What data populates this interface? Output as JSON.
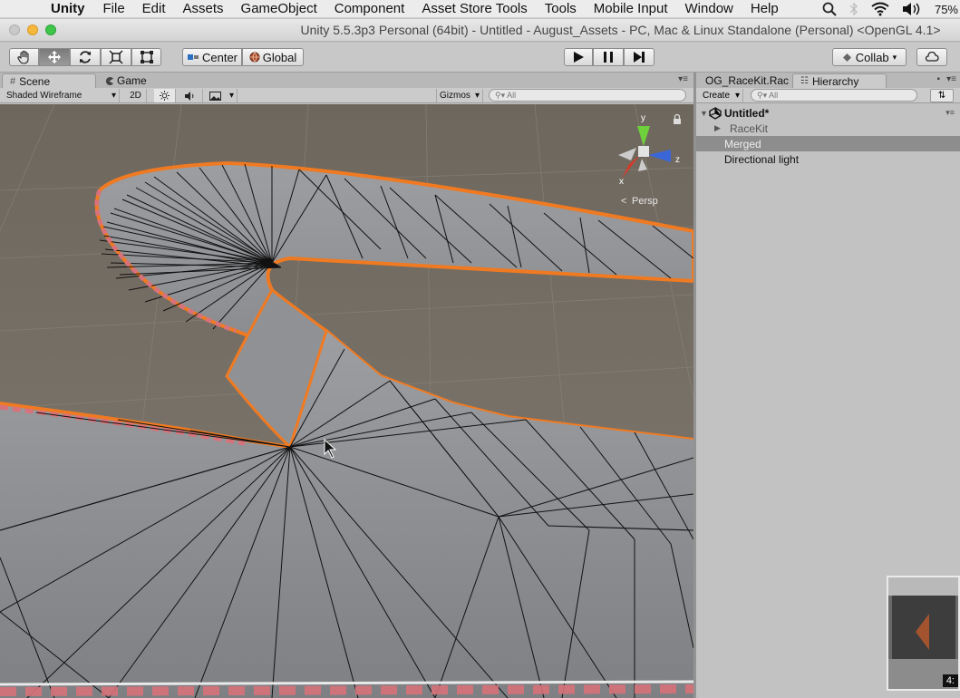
{
  "menubar": {
    "apple_glyph": "",
    "app_name": "Unity",
    "items": [
      "File",
      "Edit",
      "Assets",
      "GameObject",
      "Component",
      "Asset Store Tools",
      "Tools",
      "Mobile Input",
      "Window",
      "Help"
    ],
    "battery": "75%"
  },
  "window": {
    "title": "Unity 5.5.3p3 Personal (64bit) - Untitled - August_Assets - PC, Mac & Linux Standalone (Personal) <OpenGL 4.1>"
  },
  "toolbar": {
    "pivot_label": "Center",
    "space_label": "Global",
    "collab_label": "Collab",
    "colors": {
      "accent_active": "#7a7a7a"
    }
  },
  "scene": {
    "tab_scene": "Scene",
    "tab_game": "Game",
    "shading_mode": "Shaded Wireframe",
    "mode_2d": "2D",
    "gizmos_label": "Gizmos",
    "search_placeholder": "All",
    "view_label": "Persp",
    "gizmo_axes": {
      "y": "y",
      "z": "z",
      "x": "x"
    },
    "colors": {
      "track_outline": "#f07a22",
      "ground": "#736d64",
      "track_surface": "#8d8f92"
    }
  },
  "hierarchy": {
    "tab_project": "OG_RaceKit.Rac",
    "tab_hierarchy": "Hierarchy",
    "create_label": "Create",
    "search_placeholder": "All",
    "scene_name": "Untitled*",
    "items": [
      {
        "label": "RaceKit",
        "expandable": true,
        "selected": false
      },
      {
        "label": "Merged",
        "expandable": false,
        "selected": true
      },
      {
        "label": "Directional light",
        "expandable": false,
        "selected": false
      }
    ]
  },
  "video": {
    "timestamp": "4:"
  }
}
